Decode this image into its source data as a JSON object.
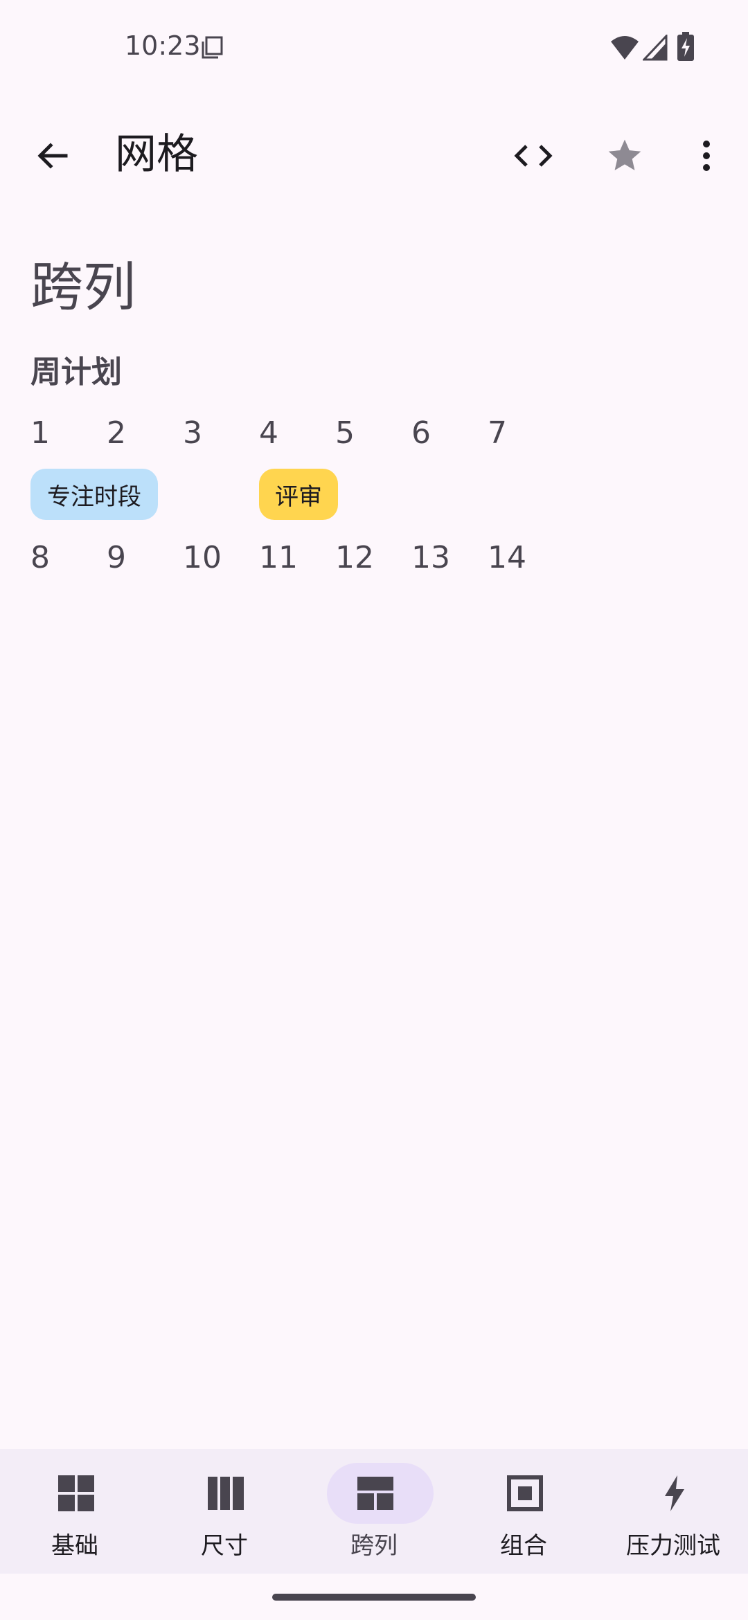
{
  "status_bar": {
    "time": "10:23"
  },
  "top_bar": {
    "title": "网格"
  },
  "content": {
    "heading": "跨列",
    "subheading": "周计划",
    "week1": [
      "1",
      "2",
      "3",
      "4",
      "5",
      "6",
      "7"
    ],
    "week2": [
      "8",
      "9",
      "10",
      "11",
      "12",
      "13",
      "14"
    ],
    "chips": [
      {
        "label": "专注时段",
        "color": "#BCE0FA"
      },
      {
        "label": "评审",
        "color": "#FFD54F"
      }
    ]
  },
  "bottom_nav": {
    "items": [
      {
        "label": "基础",
        "icon": "grid-icon"
      },
      {
        "label": "尺寸",
        "icon": "columns-icon"
      },
      {
        "label": "跨列",
        "icon": "span-layout-icon",
        "active": true
      },
      {
        "label": "组合",
        "icon": "frame-icon"
      },
      {
        "label": "压力测试",
        "icon": "bolt-icon"
      }
    ]
  },
  "colors": {
    "background": "#FDF7FC",
    "nav_background": "#F3EDF7",
    "active_indicator": "#E8DEF8",
    "icon": "#49454F"
  }
}
